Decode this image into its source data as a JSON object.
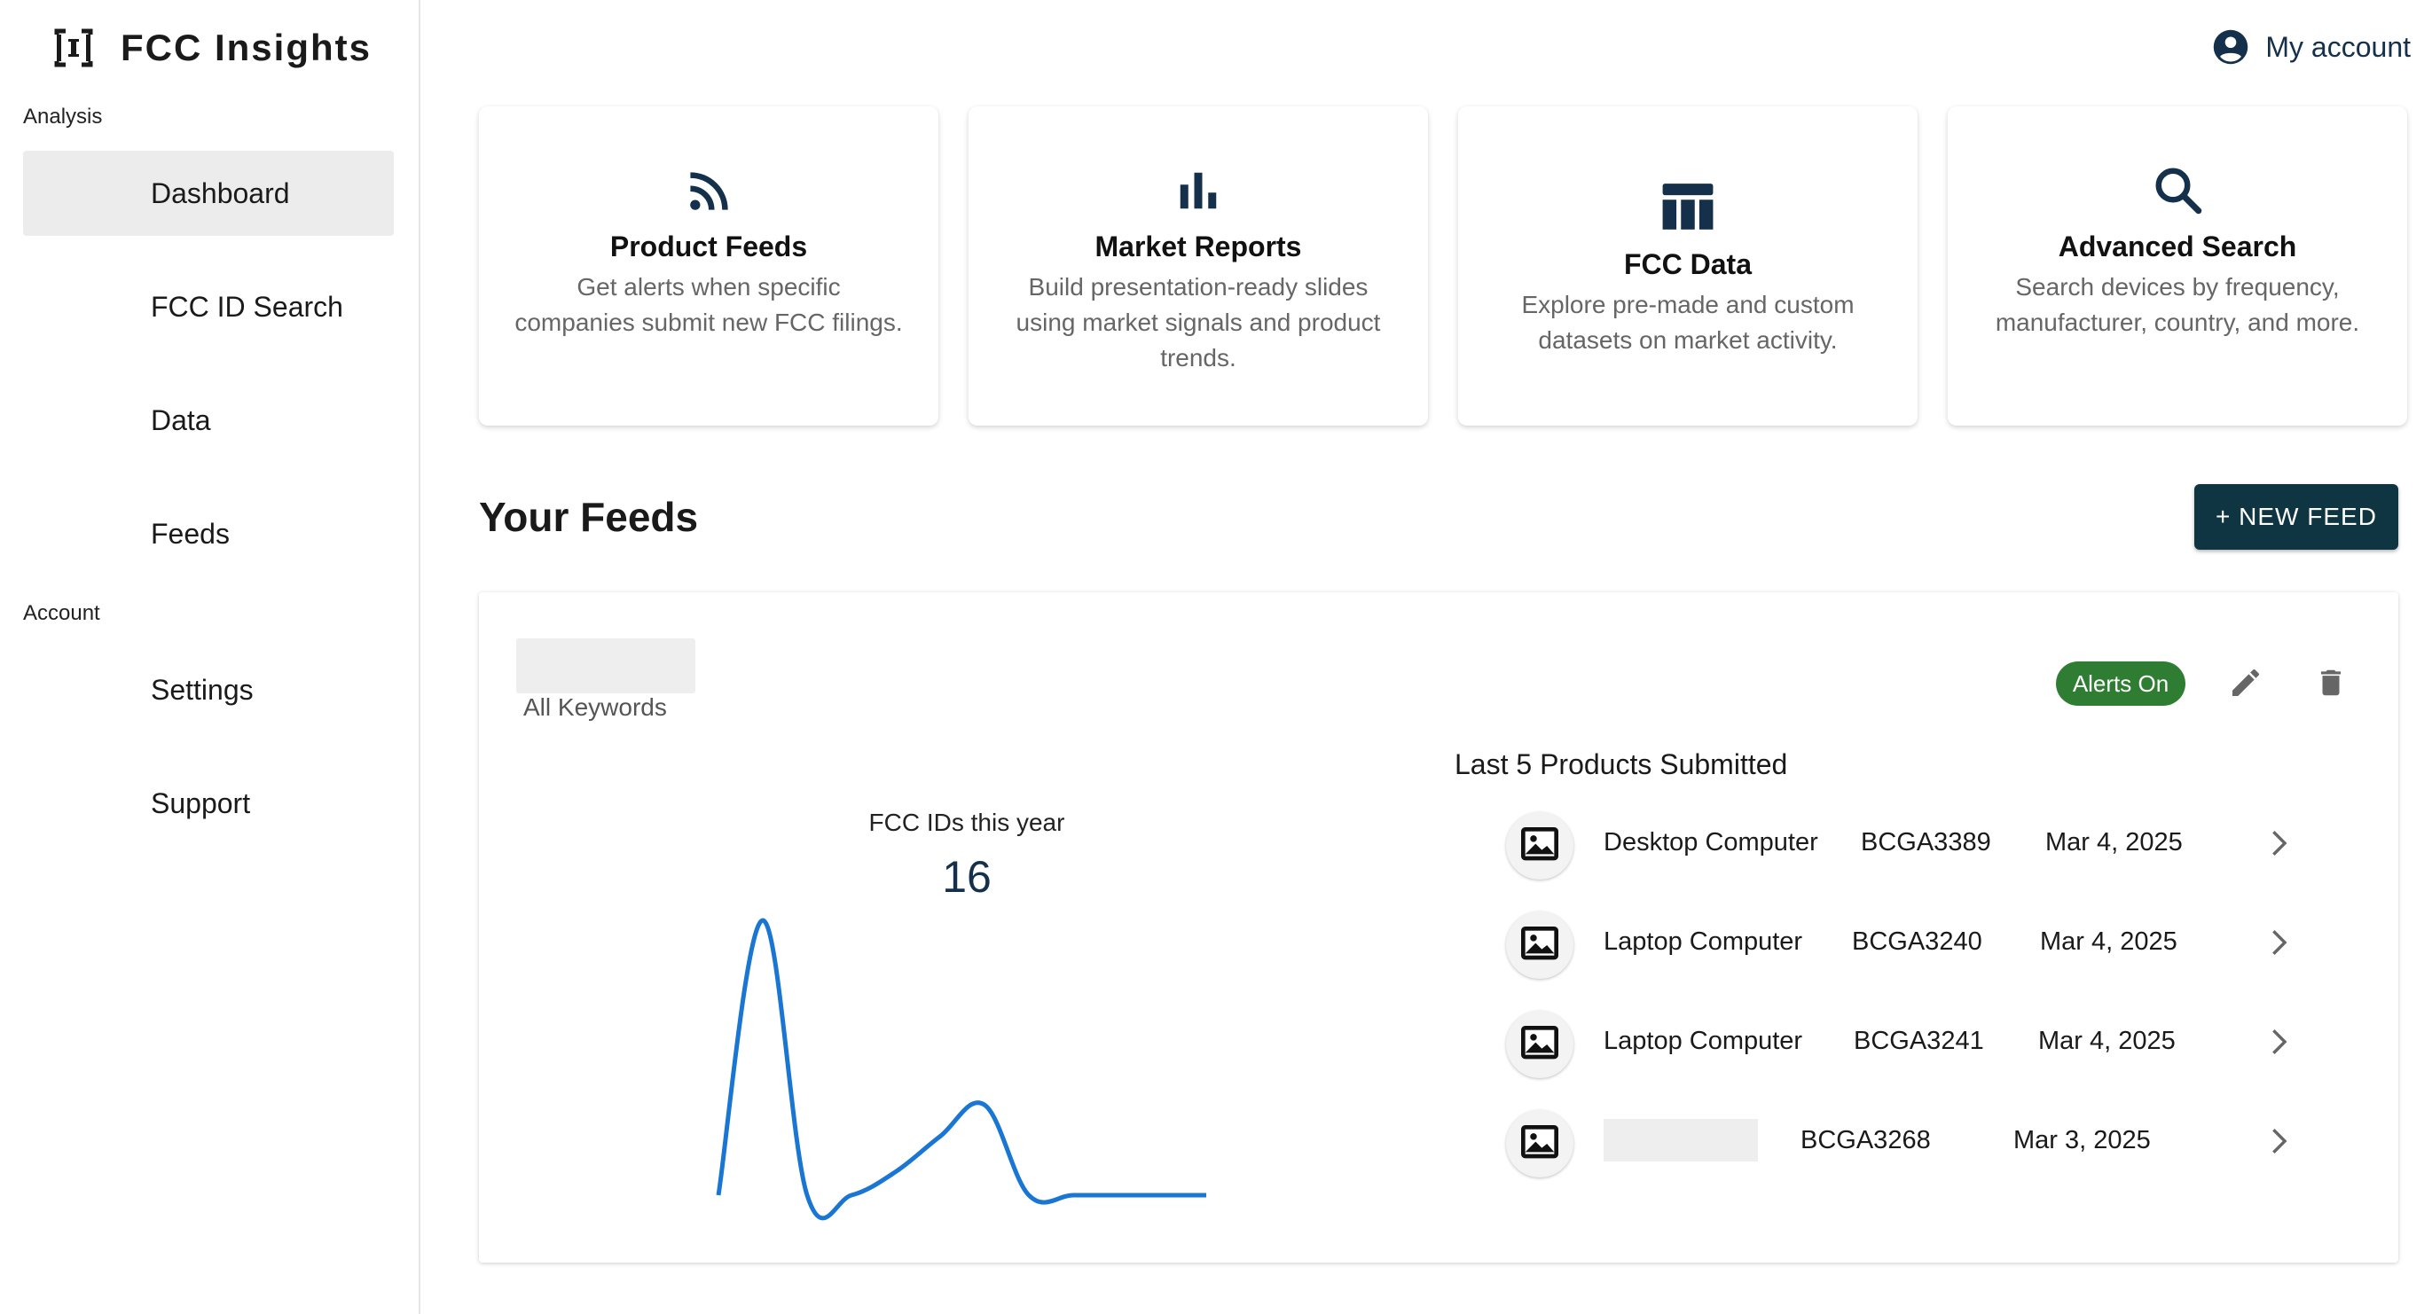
{
  "brand": {
    "name": "FCC Insights",
    "logo_icon": "bracket-logo-icon"
  },
  "sidebar": {
    "sections": [
      {
        "label": "Analysis",
        "items": [
          {
            "label": "Dashboard",
            "active": true
          },
          {
            "label": "FCC ID Search",
            "active": false
          },
          {
            "label": "Data",
            "active": false
          },
          {
            "label": "Feeds",
            "active": false
          }
        ]
      },
      {
        "label": "Account",
        "items": [
          {
            "label": "Settings",
            "active": false
          },
          {
            "label": "Support",
            "active": false
          }
        ]
      }
    ]
  },
  "header": {
    "account_label": "My account",
    "account_icon": "account-circle-icon"
  },
  "cards": [
    {
      "title": "Product Feeds",
      "description": "Get alerts when specific companies submit new FCC filings.",
      "icon": "rss-feed-icon"
    },
    {
      "title": "Market Reports",
      "description": "Build presentation-ready slides using market signals and product trends.",
      "icon": "bar-chart-icon"
    },
    {
      "title": "FCC Data",
      "description": "Explore pre-made and custom datasets on market activity.",
      "icon": "table-icon"
    },
    {
      "title": "Advanced Search",
      "description": "Search devices by frequency, manufacturer, country, and more.",
      "icon": "search-icon"
    }
  ],
  "feeds": {
    "title": "Your Feeds",
    "new_feed_label": "+ NEW FEED",
    "feed": {
      "name": "",
      "subtitle": "All Keywords",
      "alerts_label": "Alerts On",
      "alerts_color": "#2e7d32",
      "edit_icon": "pencil-icon",
      "delete_icon": "trash-icon",
      "chart_title": "FCC IDs this year",
      "chart_value": "16",
      "products_title": "Last 5 Products Submitted",
      "products": [
        {
          "name": "Desktop Computer",
          "fcc_id": "BCGA3389",
          "date": "Mar 4, 2025"
        },
        {
          "name": "Laptop Computer",
          "fcc_id": "BCGA3240",
          "date": "Mar 4, 2025"
        },
        {
          "name": "Laptop Computer",
          "fcc_id": "BCGA3241",
          "date": "Mar 4, 2025"
        },
        {
          "name": "",
          "fcc_id": "BCGA3268",
          "date": "Mar 3, 2025"
        }
      ]
    }
  },
  "chart_data": {
    "type": "line",
    "x": [
      0,
      1,
      2,
      3,
      4,
      5,
      6,
      7,
      8,
      9,
      10,
      11
    ],
    "values": [
      0,
      7,
      0,
      0,
      0.6,
      1.5,
      2.3,
      0,
      0,
      0,
      0,
      0
    ],
    "title": "FCC IDs this year",
    "xlabel": "",
    "ylabel": "",
    "ylim": [
      0,
      7
    ],
    "grid": false,
    "color": "#1976d2"
  },
  "colors": {
    "primary": "#0f3442",
    "accent": "#14304a",
    "line": "#1976d2"
  }
}
